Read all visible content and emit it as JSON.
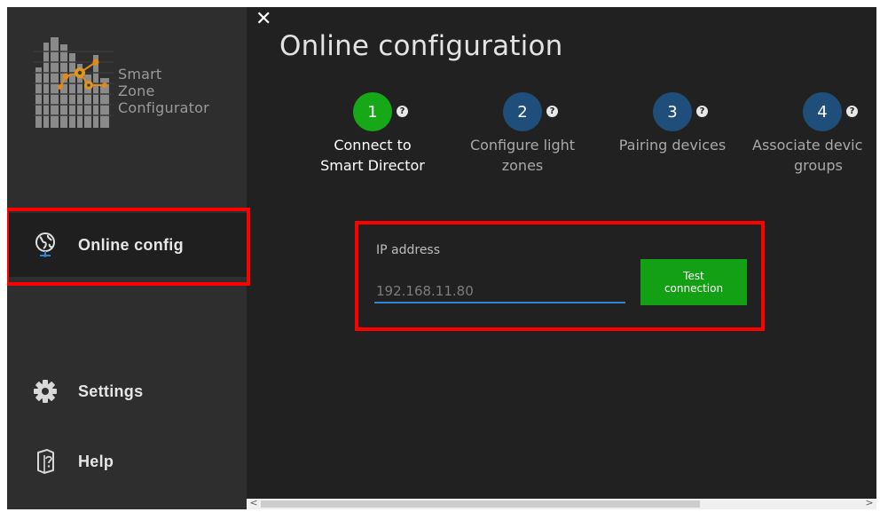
{
  "app": {
    "logo_lines": [
      "Smart",
      "Zone",
      "Configurator"
    ]
  },
  "sidebar": {
    "items": [
      {
        "label": "Online config",
        "icon": "globe-icon",
        "active": true
      },
      {
        "label": "Settings",
        "icon": "gear-icon",
        "active": false
      },
      {
        "label": "Help",
        "icon": "help-book-icon",
        "active": false
      }
    ]
  },
  "header": {
    "close_glyph": "✕",
    "title": "Online configuration"
  },
  "steps": [
    {
      "number": "1",
      "help": "?",
      "line1": "Connect to",
      "line2": "Smart Director",
      "state": "active",
      "color": "#17a817"
    },
    {
      "number": "2",
      "help": "?",
      "line1": "Configure light",
      "line2": "zones",
      "state": "inactive",
      "color": "#1f4e7a"
    },
    {
      "number": "3",
      "help": "?",
      "line1": "Pairing devices",
      "line2": "",
      "state": "inactive",
      "color": "#1f4e7a"
    },
    {
      "number": "4",
      "help": "?",
      "line1": "Associate devic",
      "line2": "groups",
      "state": "inactive",
      "color": "#1f4e7a"
    }
  ],
  "form": {
    "ip_label": "IP address",
    "ip_value": "192.168.11.80",
    "test_button_line1": "Test",
    "test_button_line2": "connection"
  },
  "colors": {
    "accent_green": "#14a014",
    "input_underline": "#2f86d6",
    "highlight": "#ff0000"
  },
  "scrollbar": {
    "left_arrow": "<",
    "right_arrow": ">"
  }
}
